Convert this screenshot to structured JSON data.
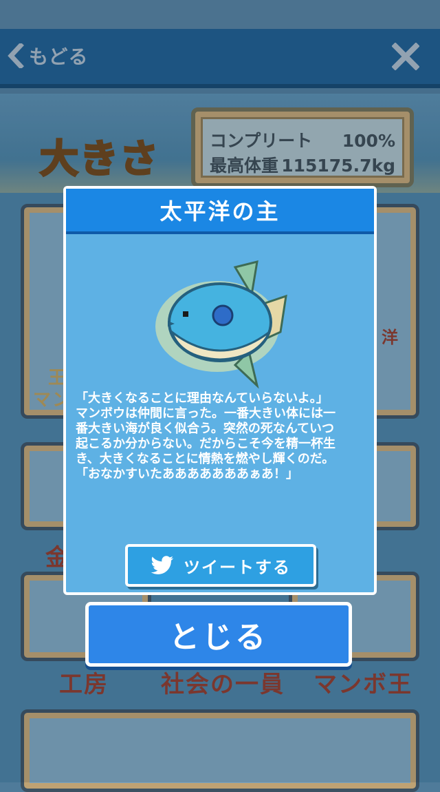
{
  "nav": {
    "back_label": "もどる"
  },
  "banner": {
    "title": "大きさ"
  },
  "stats": {
    "complete_label": "コンプリート",
    "complete_value": "100%",
    "max_weight_label": "最高体重",
    "max_weight_value": "115175.7kg"
  },
  "grid": {
    "row2_left_fragment": "金",
    "row3_labels": [
      "工房",
      "社会の一員",
      "マンボ王"
    ],
    "row1_right_fragment": "洋",
    "row1_left_fragment_a": "王",
    "row1_left_fragment_b": "マン"
  },
  "modal": {
    "title": "太平洋の主",
    "lines": [
      "「大きくなることに理由なんていらないよ。」",
      "マンボウは仲間に言った。一番大きい体には一",
      "番大きい海が良く似合う。突然の死なんていつ",
      "起こるか分からない。だからこそ今を精一杯生",
      "き、大きくなることに情熱を燃やし輝くのだ。",
      "「おなかすいたあああああああぁあ！」"
    ],
    "tweet_label": "ツイートする",
    "close_label": "とじる"
  },
  "colors": {
    "nav_bg": "#1f5c8e",
    "modal_bg": "#5eb1e4",
    "modal_header": "#1b87e4",
    "close_button": "#2e86e8",
    "tweet_button": "#2ea0e2"
  },
  "icons": [
    "back-chevron-icon",
    "close-x-icon",
    "twitter-bird-icon",
    "sunfish-icon"
  ]
}
